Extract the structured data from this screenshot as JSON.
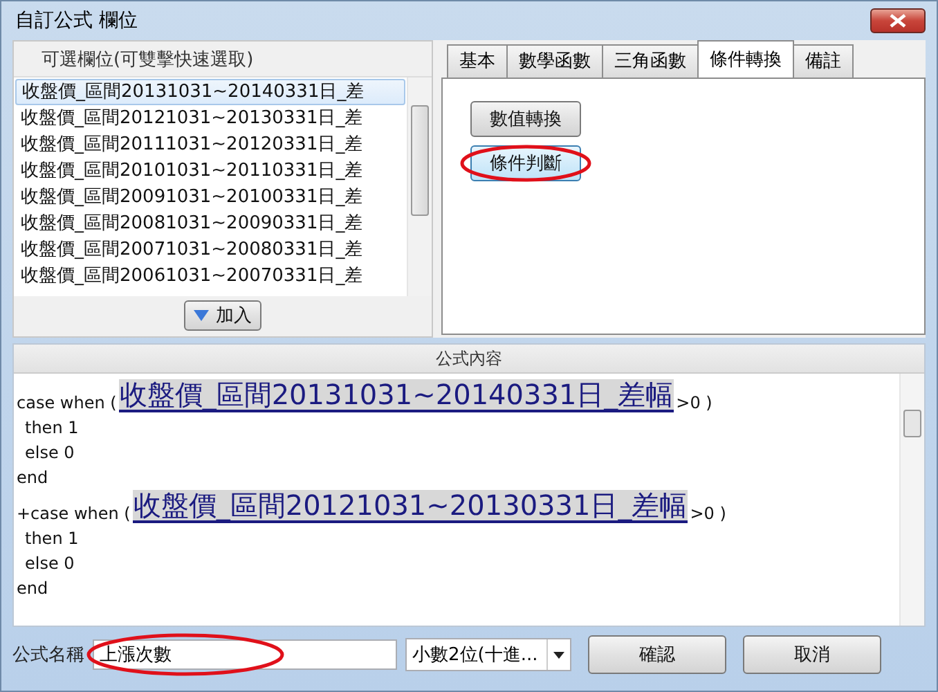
{
  "window": {
    "title": "自訂公式 欄位"
  },
  "fields_panel": {
    "title": "可選欄位(可雙擊快速選取)",
    "add_button": "加入",
    "items": [
      {
        "label": "收盤價_區間20131031~20140331日_差",
        "selected": true
      },
      {
        "label": "收盤價_區間20121031~20130331日_差",
        "selected": false
      },
      {
        "label": "收盤價_區間20111031~20120331日_差",
        "selected": false
      },
      {
        "label": "收盤價_區間20101031~20110331日_差",
        "selected": false
      },
      {
        "label": "收盤價_區間20091031~20100331日_差",
        "selected": false
      },
      {
        "label": "收盤價_區間20081031~20090331日_差",
        "selected": false
      },
      {
        "label": "收盤價_區間20071031~20080331日_差",
        "selected": false
      },
      {
        "label": "收盤價_區間20061031~20070331日_差",
        "selected": false
      }
    ]
  },
  "tabs": [
    {
      "label": "基本",
      "selected": false
    },
    {
      "label": "數學函數",
      "selected": false
    },
    {
      "label": "三角函數",
      "selected": false
    },
    {
      "label": "條件轉換",
      "selected": true
    },
    {
      "label": "備註",
      "selected": false
    }
  ],
  "tab_buttons": [
    {
      "label": "數值轉換",
      "highlighted": false
    },
    {
      "label": "條件判斷",
      "highlighted": true
    }
  ],
  "formula": {
    "title": "公式內容",
    "blocks": [
      {
        "prefix": "case when (",
        "field": "收盤價_區間20131031~20140331日_差幅",
        "suffix": ">0 )",
        "lines": [
          "then 1",
          "else 0",
          "end"
        ]
      },
      {
        "prefix": "+case when (",
        "field": "收盤價_區間20121031~20130331日_差幅",
        "suffix": ">0 )",
        "lines": [
          "then 1",
          "else 0",
          "end"
        ]
      }
    ]
  },
  "footer": {
    "name_label": "公式名稱",
    "name_value": "上漲次數",
    "name_highlighted": true,
    "format": "小數2位(十進...",
    "confirm": "確認",
    "cancel": "取消"
  }
}
